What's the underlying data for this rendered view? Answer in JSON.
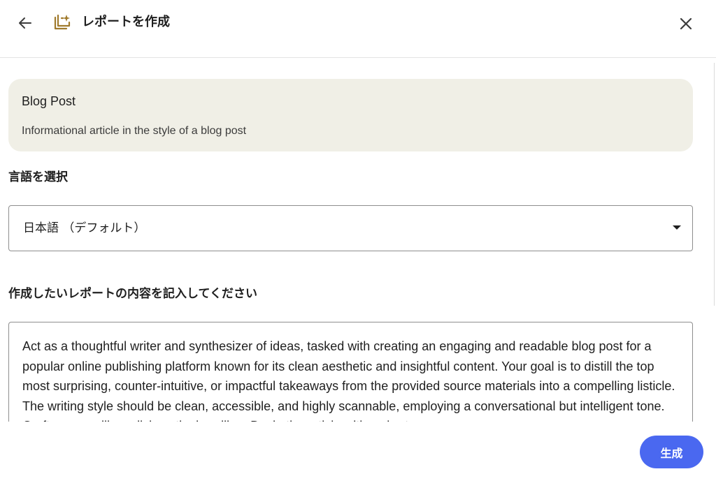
{
  "header": {
    "back_icon": "arrow-left-icon",
    "report_icon": "report-sparkle-icon",
    "title": "レポートを作成",
    "close_icon": "close-icon"
  },
  "format_card": {
    "title": "Blog Post",
    "description": "Informational article in the style of a blog post"
  },
  "language": {
    "label": "言語を選択",
    "selected": "日本語 （デフォルト）",
    "dropdown_icon": "caret-down-icon"
  },
  "prompt": {
    "label": "作成したいレポートの内容を記入してください",
    "value": "Act as a thoughtful writer and synthesizer of ideas, tasked with creating an engaging and readable blog post for a popular online publishing platform known for its clean aesthetic and insightful content. Your goal is to distill the top most surprising, counter-intuitive, or impactful takeaways from the provided source materials into a compelling listicle. The writing style should be clean, accessible, and highly scannable, employing a conversational but intelligent tone. Craft a compelling, clickworthy headline. Begin the article with a short"
  },
  "actions": {
    "generate_label": "生成"
  },
  "colors": {
    "card_background": "#f0efe6",
    "accent": "#4a68f0",
    "report_icon": "#a07a2c"
  }
}
